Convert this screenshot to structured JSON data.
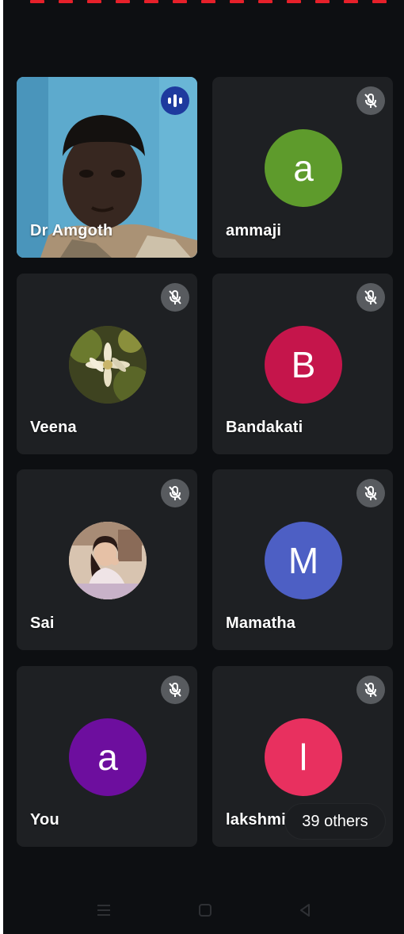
{
  "participants": [
    {
      "name": "Dr Amgoth",
      "initial": "",
      "avatar_color": "",
      "video": true,
      "muted": false,
      "speaking": true
    },
    {
      "name": "ammaji",
      "initial": "a",
      "avatar_color": "#5e9b2c",
      "muted": true
    },
    {
      "name": "Veena",
      "initial": "",
      "avatar_color": "#4a4f24",
      "photo": "flower-photo",
      "muted": true
    },
    {
      "name": "Bandakati",
      "initial": "B",
      "avatar_color": "#c5154b",
      "muted": true
    },
    {
      "name": "Sai",
      "initial": "",
      "avatar_color": "#c9a98f",
      "photo": "person-photo",
      "muted": true
    },
    {
      "name": "Mamatha",
      "initial": "M",
      "avatar_color": "#4d5fc4",
      "muted": true
    },
    {
      "name": "You",
      "initial": "a",
      "avatar_color": "#6d0e9e",
      "muted": true
    },
    {
      "name": "lakshmi",
      "initial": "l",
      "avatar_color": "#e8305f",
      "muted": true
    }
  ],
  "others_label": "39 others",
  "colors": {
    "background": "#0d0f12",
    "tile": "#1e2023",
    "mic_off_badge": "#585b5f",
    "speaking_badge": "#1e3a9e"
  },
  "icons": {
    "mic_off": "mic-off-icon",
    "speaking": "audio-level-icon",
    "nav_menu": "recent-apps-icon",
    "nav_home": "home-icon",
    "nav_back": "back-icon"
  }
}
